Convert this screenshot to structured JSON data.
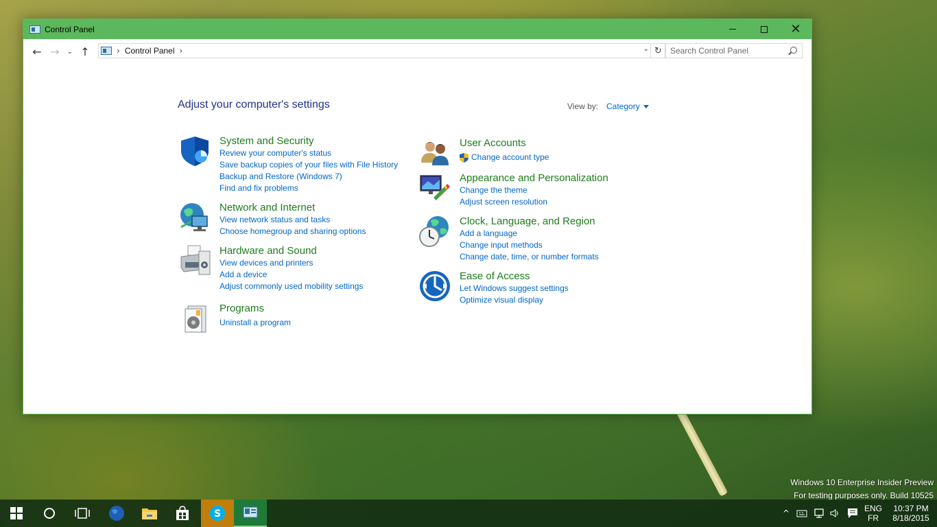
{
  "window": {
    "title": "Control Panel"
  },
  "titlebar_buttons": {
    "minimize": "minimize-icon",
    "maximize": "maximize-icon",
    "close": "close-icon"
  },
  "address": {
    "crumb": "Control Panel"
  },
  "search": {
    "placeholder": "Search Control Panel"
  },
  "page": {
    "title": "Adjust your computer's settings",
    "view_by_label": "View by:",
    "view_by_value": "Category"
  },
  "categories": {
    "system_security": {
      "title": "System and Security",
      "links": [
        "Review your computer's status",
        "Save backup copies of your files with File History",
        "Backup and Restore (Windows 7)",
        "Find and fix problems"
      ]
    },
    "network": {
      "title": "Network and Internet",
      "links": [
        "View network status and tasks",
        "Choose homegroup and sharing options"
      ]
    },
    "hardware": {
      "title": "Hardware and Sound",
      "links": [
        "View devices and printers",
        "Add a device",
        "Adjust commonly used mobility settings"
      ]
    },
    "programs": {
      "title": "Programs",
      "links": [
        "Uninstall a program"
      ]
    },
    "user_accounts": {
      "title": "User Accounts",
      "links": [
        "Change account type"
      ]
    },
    "appearance": {
      "title": "Appearance and Personalization",
      "links": [
        "Change the theme",
        "Adjust screen resolution"
      ]
    },
    "clock": {
      "title": "Clock, Language, and Region",
      "links": [
        "Add a language",
        "Change input methods",
        "Change date, time, or number formats"
      ]
    },
    "ease": {
      "title": "Ease of Access",
      "links": [
        "Let Windows suggest settings",
        "Optimize visual display"
      ]
    }
  },
  "watermark": {
    "line1": "Windows 10 Enterprise Insider Preview",
    "line2": "For testing purposes only. Build 10525"
  },
  "tray": {
    "lang_primary": "ENG",
    "lang_secondary": "FR",
    "time": "10:37 PM",
    "date": "8/18/2015"
  },
  "colors": {
    "titlebar": "#5cb85c",
    "category_title": "#1c7d1c",
    "link": "#0066cc",
    "page_title": "#1e3287"
  }
}
